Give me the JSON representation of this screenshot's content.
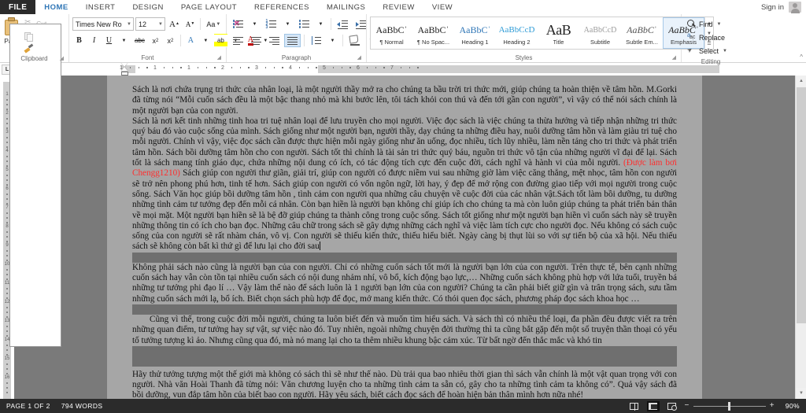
{
  "window": {
    "signin_label": "Sign in",
    "account_icon": "account-icon"
  },
  "ribbon_tabs": [
    {
      "label": "FILE",
      "active": false
    },
    {
      "label": "HOME",
      "active": true
    },
    {
      "label": "INSERT",
      "active": false
    },
    {
      "label": "DESIGN",
      "active": false
    },
    {
      "label": "PAGE LAYOUT",
      "active": false
    },
    {
      "label": "REFERENCES",
      "active": false
    },
    {
      "label": "MAILINGS",
      "active": false
    },
    {
      "label": "REVIEW",
      "active": false
    },
    {
      "label": "VIEW",
      "active": false
    }
  ],
  "clipboard": {
    "group_label": "Clipboard",
    "paste_label": "Paste",
    "cut_label": "Cut",
    "copy_label": "Copy",
    "format_painter_label": "Format Painter"
  },
  "font": {
    "group_label": "Font",
    "font_name": "Times New Ro",
    "font_size": "12",
    "grow_label": "A",
    "shrink_label": "A",
    "change_case_label": "Aa",
    "clear_formatting_label": "clear-formatting-icon",
    "bold_label": "B",
    "italic_label": "I",
    "underline_label": "U",
    "strikethrough_label": "abc",
    "subscript_label": "x",
    "superscript_label": "x",
    "text_effects_label": "A",
    "highlight_label": "ab",
    "font_color_label": "A"
  },
  "paragraph": {
    "group_label": "Paragraph",
    "bullets_label": "bullets-icon",
    "numbering_label": "numbering-icon",
    "multilevel_label": "multilevel-list-icon",
    "decrease_indent_label": "decrease-indent-icon",
    "increase_indent_label": "increase-indent-icon",
    "sort_label": "sort-icon",
    "show_marks_label": "¶",
    "align_left_label": "align-left-icon",
    "align_center_label": "align-center-icon",
    "align_right_label": "align-right-icon",
    "align_justify_label": "align-justify-icon",
    "line_spacing_label": "line-spacing-icon",
    "shading_label": "shading-icon",
    "borders_label": "borders-icon",
    "active_alignment": "justify"
  },
  "styles": {
    "group_label": "Styles",
    "items": [
      {
        "preview": "AaBbCˈ",
        "name": "¶ Normal",
        "selected": false
      },
      {
        "preview": "AaBbCˈ",
        "name": "¶ No Spac...",
        "selected": false
      },
      {
        "preview": "AaBbCˈ",
        "name": "Heading 1",
        "selected": false
      },
      {
        "preview": "AaBbCcD",
        "name": "Heading 2",
        "selected": false
      },
      {
        "preview": "AaB",
        "name": "Title",
        "selected": false
      },
      {
        "preview": "AaBbCcD",
        "name": "Subtitle",
        "selected": false
      },
      {
        "preview": "AaBbCˈ",
        "name": "Subtle Em...",
        "selected": false
      },
      {
        "preview": "AaBbCˈ",
        "name": "Emphasis",
        "selected": true
      }
    ],
    "nav_up": "▲",
    "nav_down": "▼",
    "nav_more": "▾"
  },
  "editing": {
    "group_label": "Editing",
    "find_label": "Find",
    "replace_label": "Replace",
    "select_label": "Select"
  },
  "ruler": {
    "corner_tab_label": "L",
    "horizontal_ticks": [
      "1",
      "1",
      "1",
      "2",
      "3",
      "4",
      "5",
      "6",
      "7"
    ],
    "vertical_ticks": [
      "1",
      "2",
      "3",
      "4",
      "5",
      "6",
      "7",
      "8",
      "9",
      "10",
      "11",
      "12",
      "13",
      "14",
      "15",
      "16"
    ]
  },
  "document": {
    "paragraphs": [
      {
        "id": "p1",
        "selected": true,
        "runs": [
          {
            "text": "Sách là nơi chứa trụng tri thức của nhân loại, là một người thầy mở ra cho chúng ta bầu trời tri thức mới, giúp chúng ta hoàn thiện về tâm hồn. M.Gorki đã từng nói “Mỗi cuốn sách đều là một bậc thang nhỏ mà khi bước lên, tôi tách khỏi con thú và đến tới gần con người”, vì vậy có thể nói sách chính là một người bạn của con người.",
            "color": "normal"
          }
        ]
      },
      {
        "id": "p2",
        "selected": true,
        "runs": [
          {
            "text": "Sách là nơi kết tinh những tinh hoa tri tuệ nhân loại để lưu truyền cho mọi người. Việc đọc sách là việc chúng ta thừa hưởng và tiếp nhận những tri thức quý báu đó vào cuộc sống của mình. Sách giống như một người bạn, người thầy, dạy chúng ta những điều hay, nuôi dưỡng tâm hồn và làm giàu tri tuệ cho mỗi người. Chính vì vậy, việc đọc sách cần được thực hiện mỗi ngày giống như ăn uống, đọc nhiều, tích lũy nhiều, làm nền tảng cho tri thức và phát triển tâm hồn. Sách bồi dưỡng tâm hồn cho con người. Sách tốt thì chính là tài sản tri thức quý báu, nguồn tri thức vô tận của những người vĩ đại để lại. Sách tốt là sách mang tính giáo dục, chứa những nội dung có ích, có tác động tích cực đến cuộc đời, cách nghĩ và hành vi của mỗi người. ",
            "color": "normal"
          },
          {
            "text": "(Được làm bơi Chengg1210)",
            "color": "red"
          },
          {
            "text": " Sách giúp con người thư giãn, giải trí, giúp con người có được niềm vui sau những giờ làm việc căng thẳng, mệt nhọc, tâm hồn con người sẽ trở nên phong phú hơn, tinh tế hơn. Sách giúp con người có vốn ngôn ngữ, lời hay, ý đẹp để mở rộng con đường giao tiếp với mọi người trong cuộc sống. Sách Văn học giúp bồi dưỡng tâm hồn , tình cảm con người qua những câu chuyện về cuộc đời của các nhân vật.Sách tốt làm bồi dưỡng, tu dưỡng những tình cảm tư tưởng đẹp đến mỗi cá nhân. Còn bạn hiền là người bạn không chỉ giúp ích cho chúng ta mà còn luôn giúp chúng ta phát triển bản thân về mọi mặt. Một người bạn hiền sẽ là bệ đỡ giúp chúng ta thành công trong cuộc sống. Sách tốt giống như một người bạn hiền vì cuốn sách này sẽ truyền những thông tin có ích cho bạn đọc. Những câu chữ trong sách sẽ gây dựng những cách nghĩ và việc làm tích cực cho người đọc. Nếu không có sách cuộc sống của con người sẽ rất nhàm chán, vô vị. Con người sẽ thiếu kiến thức, thiếu hiểu biết. Ngày càng bị thụt lùi so với sự tiến bộ của xã hội. Nếu thiếu sách sẽ không còn bất kì thứ gì để lưu lại cho đời sau",
            "color": "normal"
          }
        ]
      },
      {
        "id": "p3",
        "selected": true,
        "runs": [
          {
            "text": "Không phải sách nào cũng là người bạn của con người. Chỉ có những cuốn sách tốt mới là người bạn lớn của con người. Trên thực tế, bên cạnh những cuốn sách hay vẫn còn tồn tại nhiều cuốn sách có nội dung nhảm nhí, vô bổ, kích động bạo lực,…  Những cuốn sách không phù hợp với lứa tuổi, truyền bá những tư tưởng phi đạo lí … Vậy làm thế nào để sách luôn là 1 người bạn lớn của con người? Chúng ta cần phải biết giữ gìn và trân trọng sách, sưu tầm những cuốn sách mới lạ, bổ ích. Biết chọn sách phù hợp để đọc, mở mang kiến thức. Có thói quen đọc sách, phương pháp đọc sách khoa học …",
            "color": "normal"
          }
        ]
      },
      {
        "id": "p4",
        "selected": true,
        "indent": true,
        "runs": [
          {
            "text": "Cũng vì thế, trong cuộc đời mỗi người, chúng ta luôn biết đến và muốn tìm hiểu sách. Và sách thì có nhiều thể loại, đa phần đều được viết ra trên những quan điểm, tư tưởng hay sự vật, sự việc nào đó. Tuy nhiên, ngoài những chuyện đời thường thì ta cũng bắt gặp đến một số truyện thần thoại có yếu tố tưởng tượng kì ảo. Nhưng cũng qua đó, mà nó mang lại cho ta thêm nhiều khung bậc cảm xúc. Từ bất ngờ đến thắc mắc và khó tin",
            "color": "normal"
          }
        ]
      },
      {
        "id": "p5",
        "selected": false,
        "runs": [
          {
            "text": "Hãy thử tưởng tượng một thế giới mà không có sách thì sẽ như thế nào. Dù trải qua bao nhiêu thời gian thì sách vẫn chính là một vật quan trọng với con người. Nhà văn Hoài Thanh đã từng nói: Văn chương luyện cho ta những tình cảm ta sẵn có, gây cho ta những tình cảm ta không có”. Quả vậy sách đã bồi dưỡng, vun đắp tâm hồn của biết bao con người. Hãy yêu sách, biết cách đọc sách để hoàn hiện bản thân mình hơn nữa nhé!",
            "color": "normal"
          }
        ]
      }
    ]
  },
  "status": {
    "page_info": "PAGE 1 OF 2",
    "word_count": "794 WORDS",
    "view_read_label": "read-mode-icon",
    "view_print_label": "print-layout-icon",
    "view_web_label": "web-layout-icon",
    "zoom_out_label": "−",
    "zoom_in_label": "+",
    "zoom_level": "90%"
  },
  "colors": {
    "accent": "#2e75b6",
    "file_tab": "#2b2b2b",
    "selection_gray": "#a6a6a6",
    "page_backdrop": "#7a7a7a",
    "red_annotation": "#ff2d2d"
  }
}
